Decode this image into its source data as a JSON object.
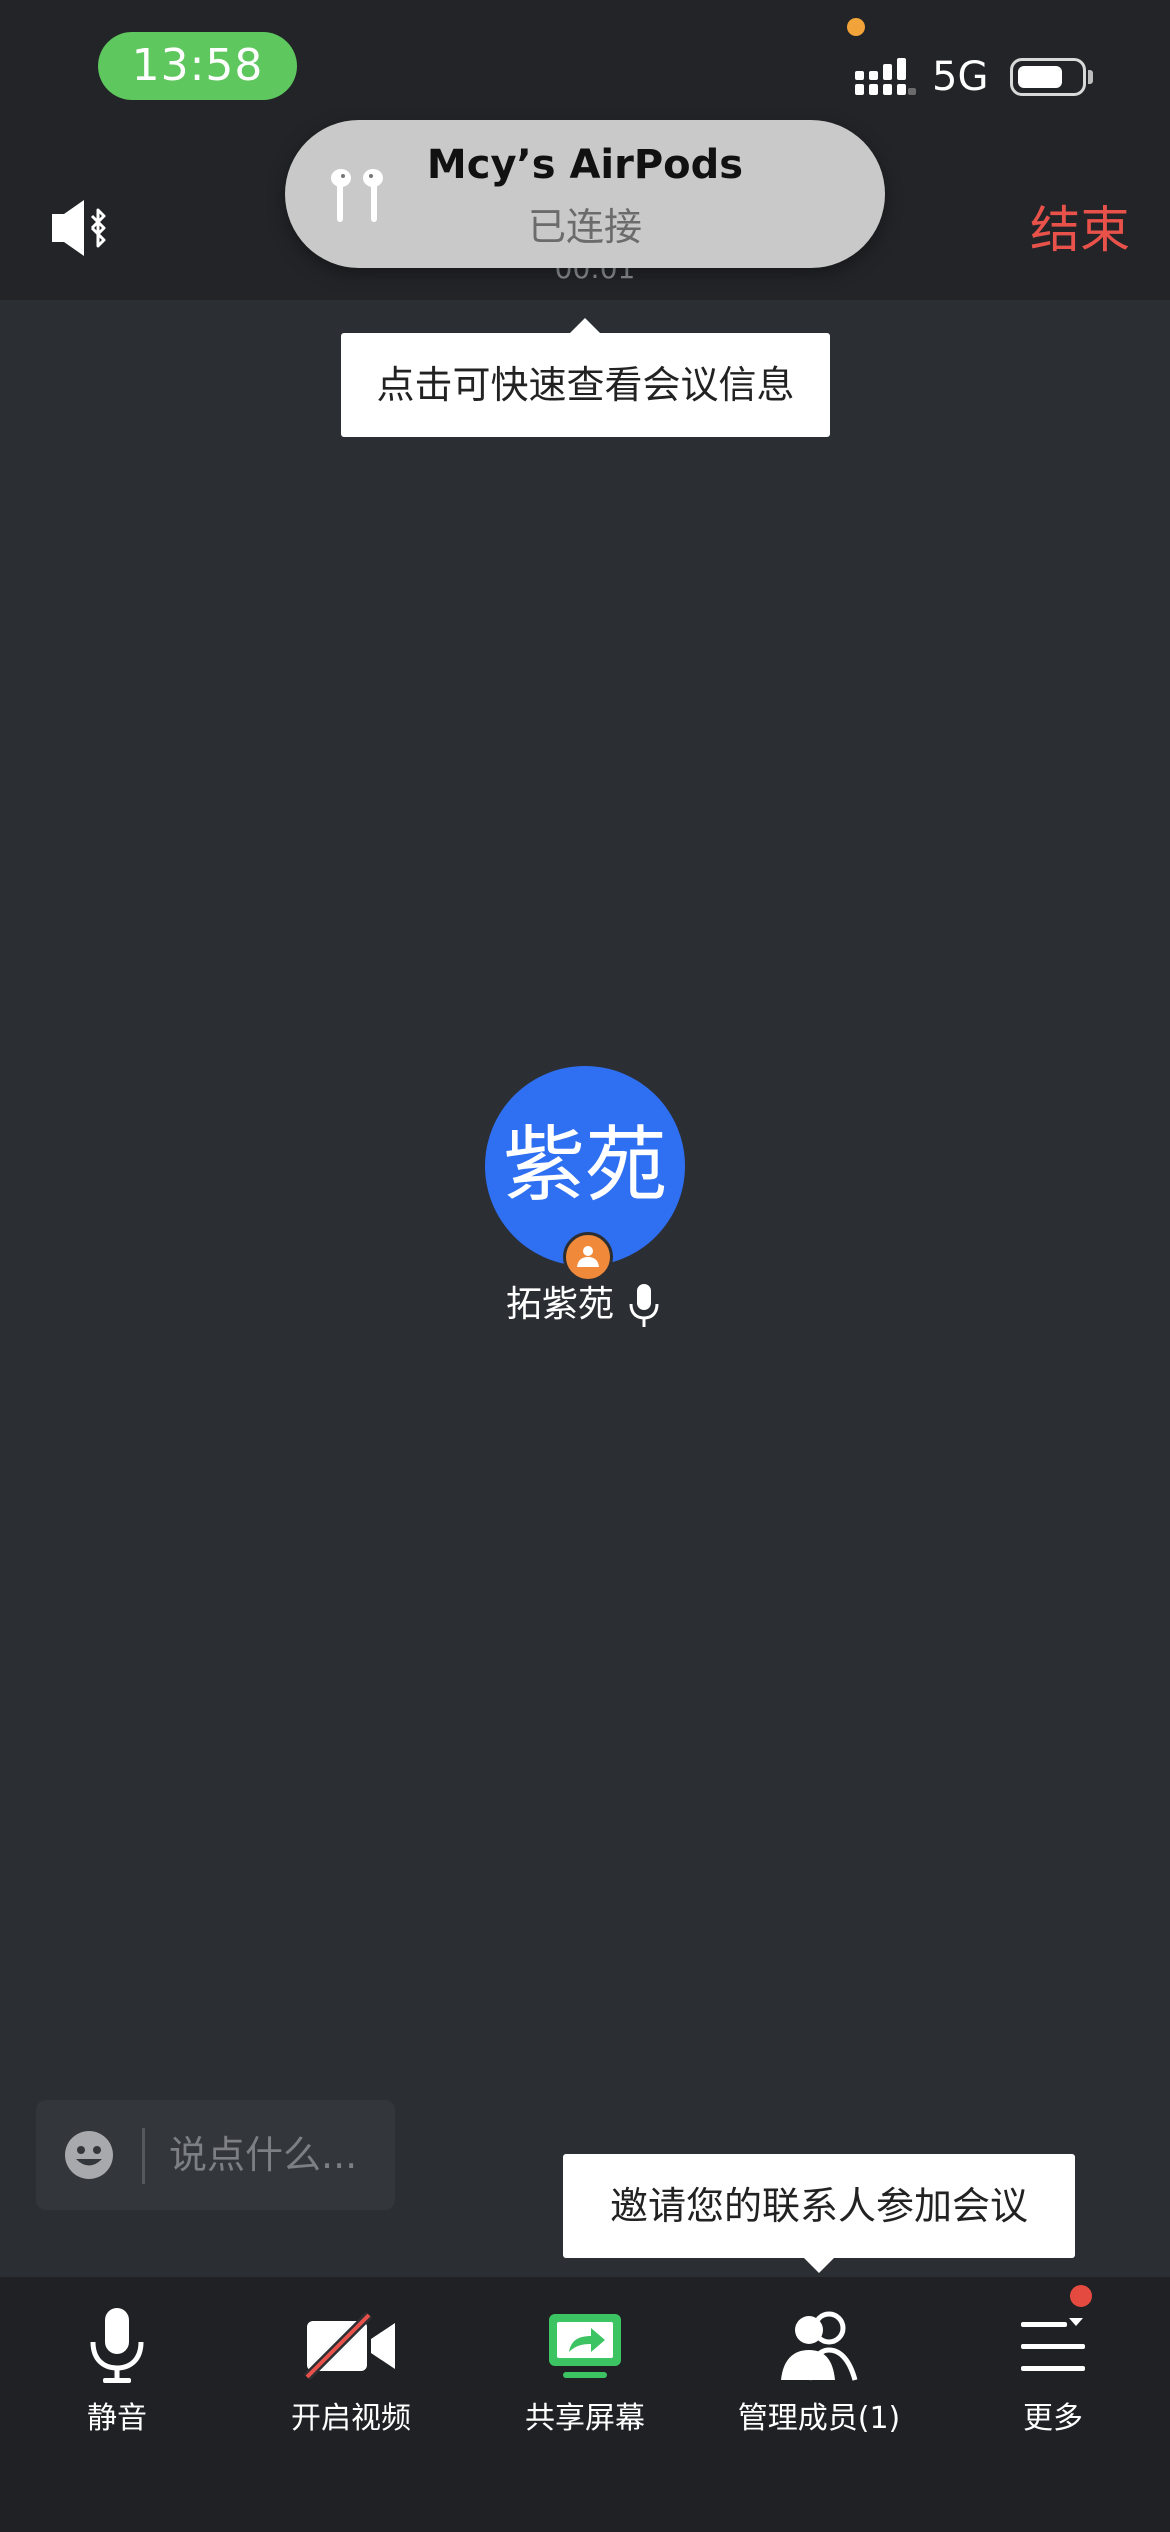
{
  "status_bar": {
    "time": "13:58",
    "network": "5G"
  },
  "header": {
    "end_label": "结束",
    "timer": "00:01"
  },
  "airpods_banner": {
    "device_name": "Mcy’s AirPods",
    "status": "已连接"
  },
  "tooltip_meeting_info": "点击可快速查看会议信息",
  "participant": {
    "avatar_text": "紫苑",
    "name": "拓紫苑"
  },
  "chat": {
    "placeholder": "说点什么..."
  },
  "tooltip_invite": "邀请您的联系人参加会议",
  "toolbar": {
    "mute": "静音",
    "video": "开启视频",
    "share": "共享屏幕",
    "members": "管理成员(1)",
    "more": "更多"
  },
  "colors": {
    "accent_blue": "#2f6ff2",
    "end_red": "#e9524a",
    "share_green": "#3cc463",
    "host_orange": "#f08a3a"
  }
}
